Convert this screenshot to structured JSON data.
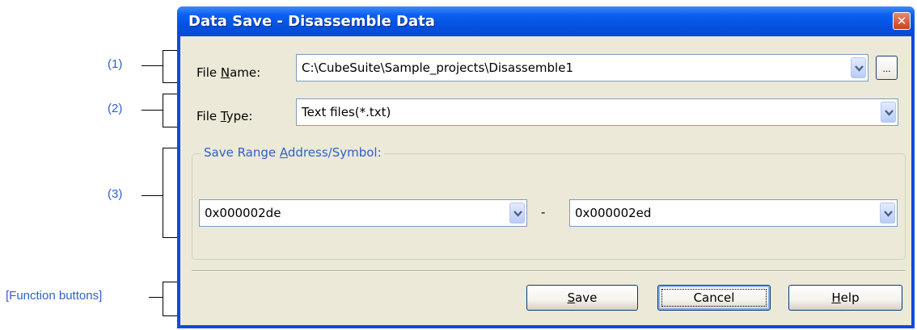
{
  "callouts": {
    "c1": "(1)",
    "c2": "(2)",
    "c3": "(3)",
    "function_buttons": "[Function buttons]"
  },
  "dialog": {
    "title": "Data Save - Disassemble Data",
    "close_icon": "close-icon"
  },
  "file_name": {
    "label_pre": "File ",
    "label_mnemonic": "N",
    "label_post": "ame:",
    "value": "C:\\CubeSuite\\Sample_projects\\Disassemble1",
    "browse_label": "..."
  },
  "file_type": {
    "label_pre": "File ",
    "label_mnemonic": "T",
    "label_post": "ype:",
    "value": "Text files(*.txt)"
  },
  "save_range": {
    "legend_pre": "Save Range ",
    "legend_mnemonic": "A",
    "legend_post": "ddress/Symbol:",
    "start": "0x000002de",
    "separator": "-",
    "end": "0x000002ed"
  },
  "buttons": {
    "save_mnemonic": "S",
    "save_rest": "ave",
    "cancel": "Cancel",
    "help_mnemonic": "H",
    "help_rest": "elp"
  },
  "colors": {
    "callout": "#2e5fcc",
    "title_bar": "#0a5ef0",
    "dialog_bg": "#ece9d8"
  }
}
